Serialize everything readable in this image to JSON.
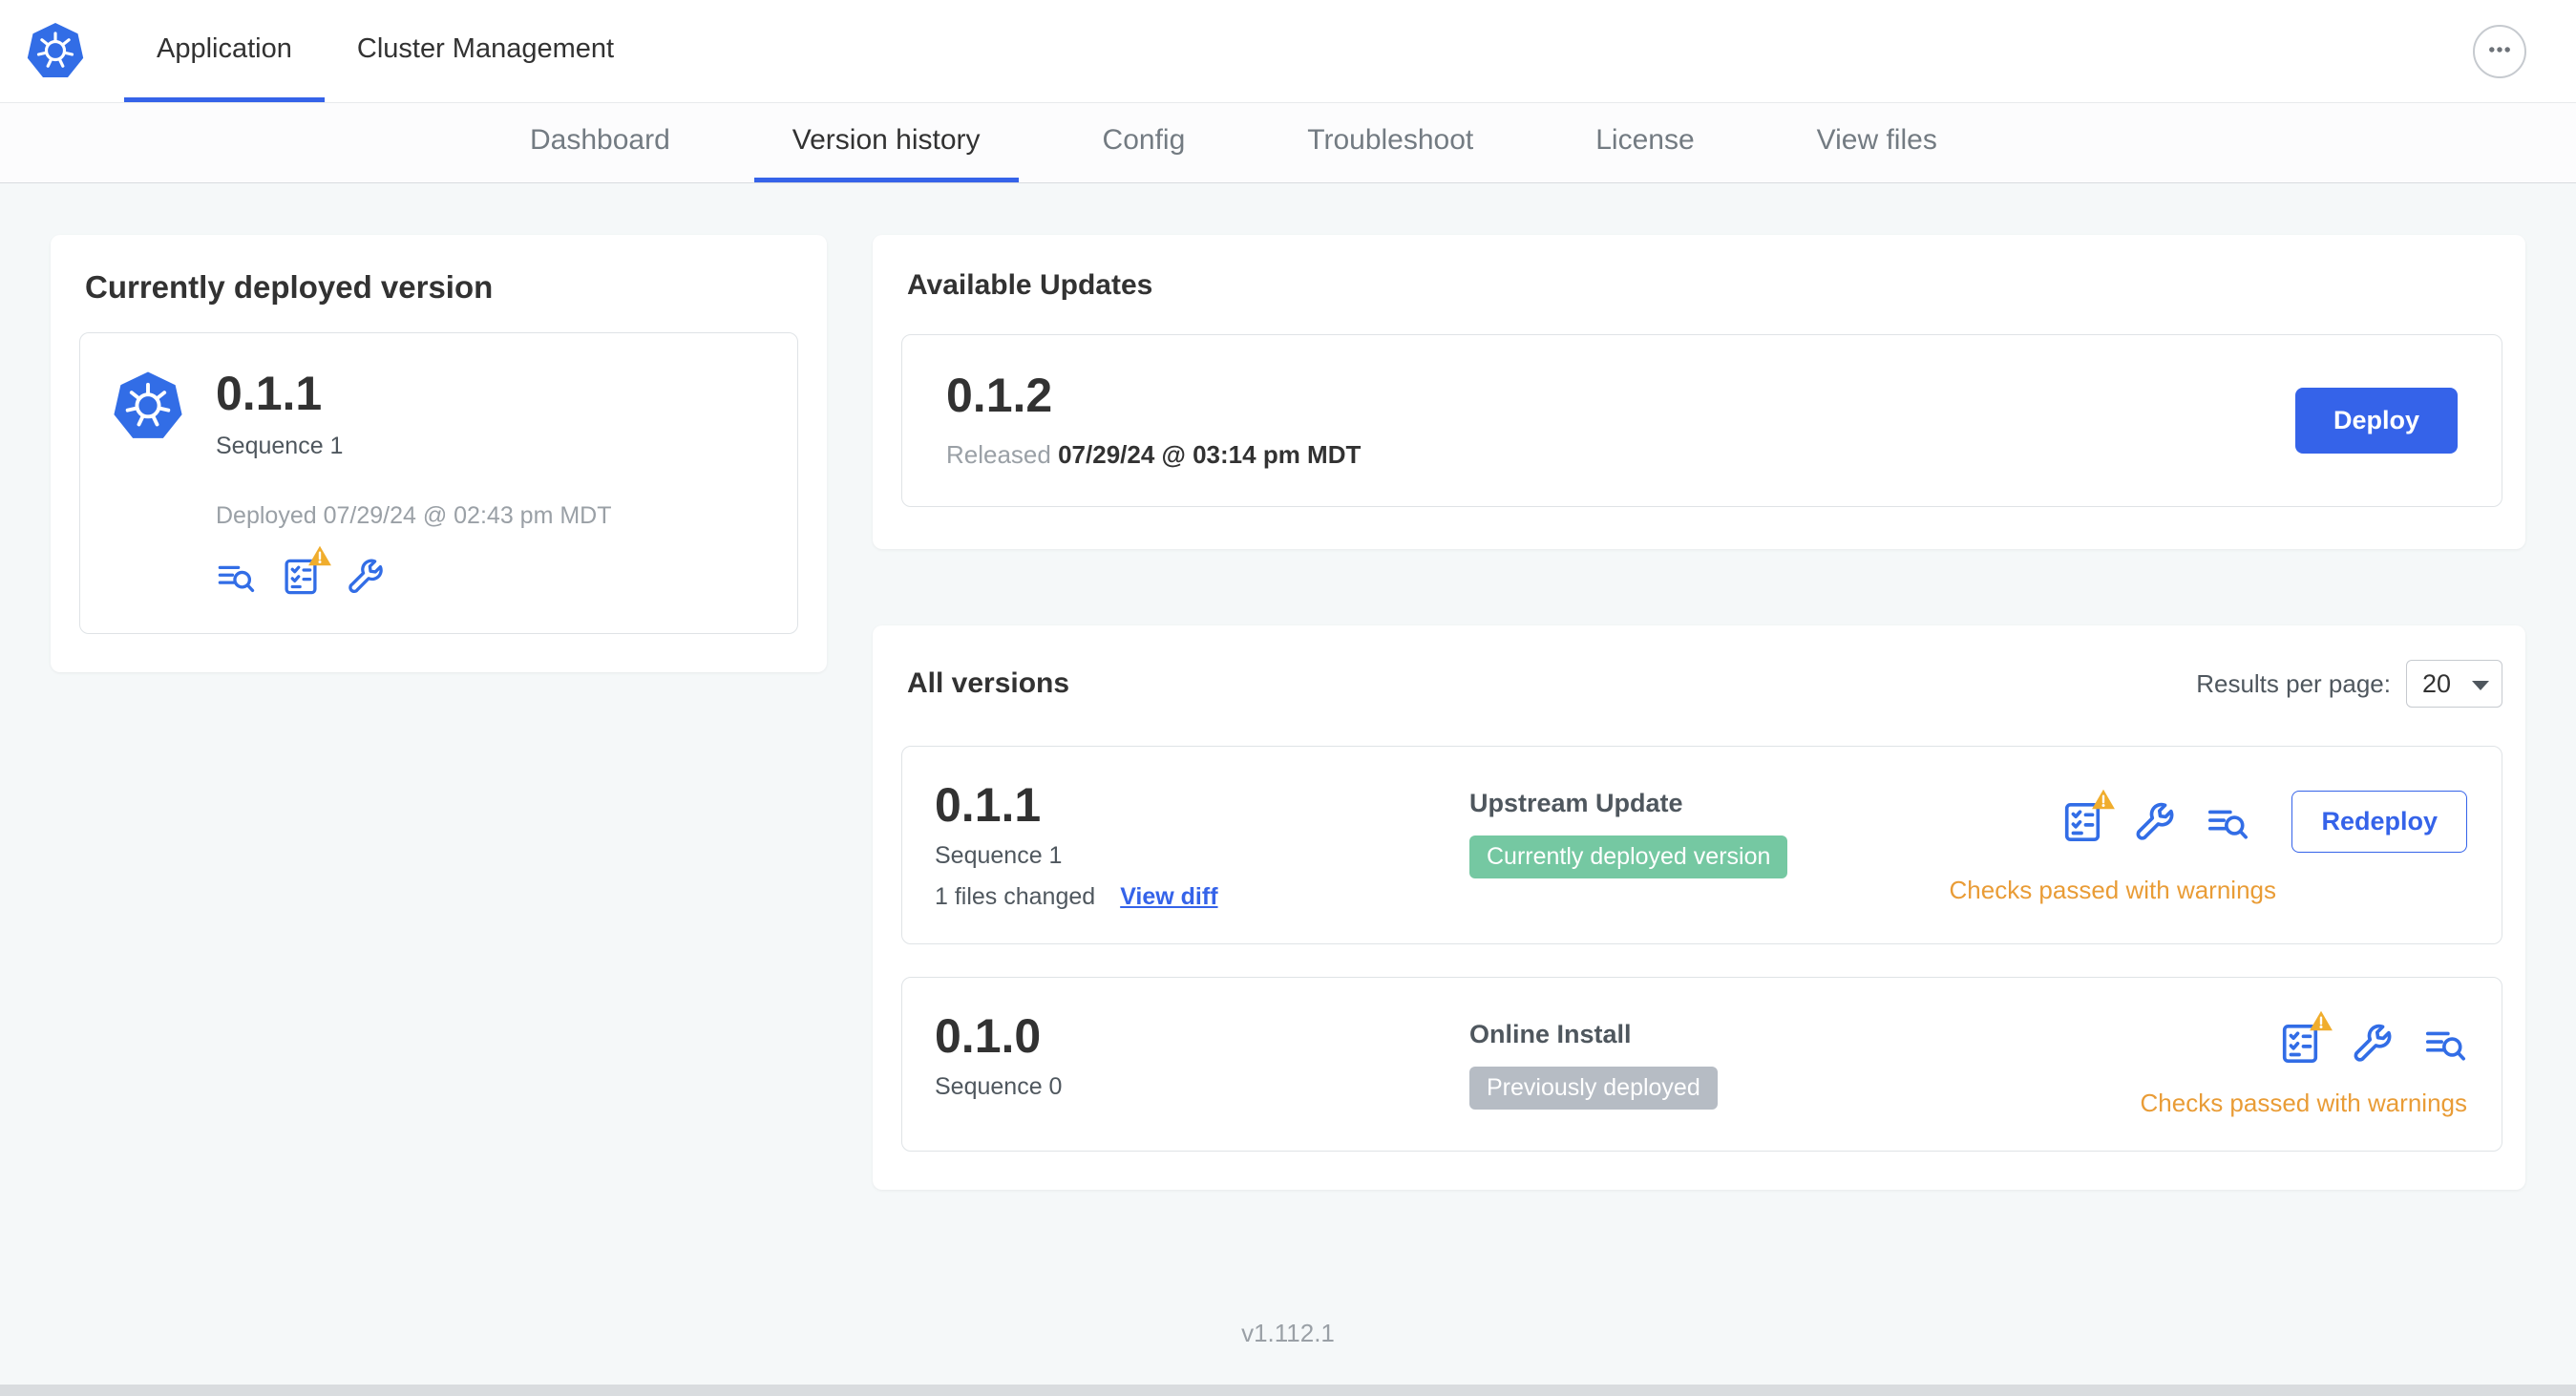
{
  "topnav": {
    "tabs": [
      {
        "label": "Application",
        "active": true
      },
      {
        "label": "Cluster Management",
        "active": false
      }
    ],
    "more_menu_icon": "ellipsis-icon"
  },
  "subnav": {
    "tabs": [
      {
        "label": "Dashboard",
        "active": false
      },
      {
        "label": "Version history",
        "active": true
      },
      {
        "label": "Config",
        "active": false
      },
      {
        "label": "Troubleshoot",
        "active": false
      },
      {
        "label": "License",
        "active": false
      },
      {
        "label": "View files",
        "active": false
      }
    ]
  },
  "current_version": {
    "title": "Currently deployed version",
    "version": "0.1.1",
    "sequence": "Sequence 1",
    "deployed": "Deployed 07/29/24 @ 02:43 pm MDT",
    "icons": [
      "version-diff-icon",
      "preflight-checks-warning-icon",
      "edit-config-icon"
    ]
  },
  "available_updates": {
    "title": "Available Updates",
    "version": "0.1.2",
    "released_label": "Released",
    "released_date": "07/29/24 @ 03:14 pm MDT",
    "deploy_button": "Deploy"
  },
  "all_versions": {
    "title": "All versions",
    "results_per_page_label": "Results per page:",
    "results_per_page_value": "20",
    "rows": [
      {
        "version": "0.1.1",
        "sequence": "Sequence 1",
        "files_changed": "1 files changed",
        "view_diff": "View diff",
        "source": "Upstream Update",
        "badge": "Currently deployed version",
        "badge_style": "green",
        "status": "Checks passed with warnings",
        "action": "Redeploy",
        "icons": [
          "preflight-checks-warning-icon",
          "edit-config-icon",
          "version-diff-icon"
        ]
      },
      {
        "version": "0.1.0",
        "sequence": "Sequence 0",
        "source": "Online Install",
        "badge": "Previously deployed",
        "badge_style": "gray",
        "status": "Checks passed with warnings",
        "icons": [
          "preflight-checks-warning-icon",
          "edit-config-icon",
          "version-diff-icon"
        ]
      }
    ]
  },
  "footer": {
    "app_version": "v1.112.1"
  },
  "colors": {
    "accent_blue": "#3563e9",
    "logo_blue": "#326de6",
    "warning_orange": "#e99c36",
    "badge_green": "#75c8a2",
    "badge_gray": "#b6bcc4",
    "background": "#f5f8f9"
  }
}
